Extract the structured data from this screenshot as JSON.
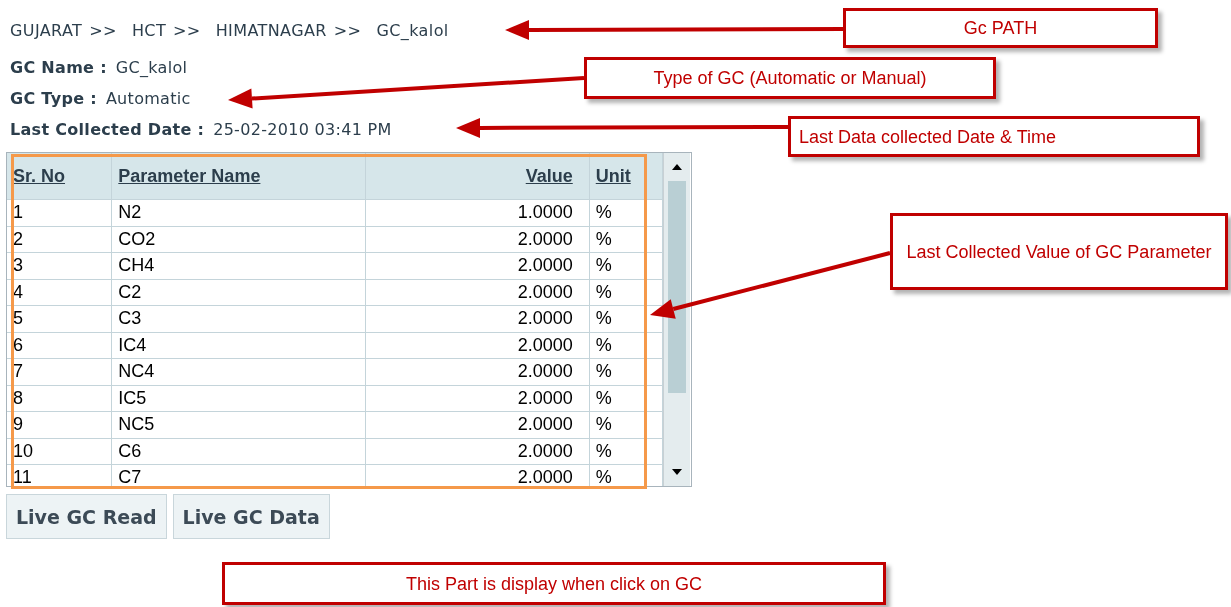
{
  "breadcrumb": [
    {
      "label": "GUJARAT"
    },
    {
      "label": "HCT"
    },
    {
      "label": "HIMATNAGAR"
    },
    {
      "label": "GC_kalol"
    }
  ],
  "breadcrumb_separator": ">>",
  "fields": [
    {
      "label": "GC Name :",
      "value": "GC_kalol"
    },
    {
      "label": "GC Type :",
      "value": "Automatic"
    },
    {
      "label": "Last Collected Date :",
      "value": "25-02-2010 03:41 PM"
    }
  ],
  "table": {
    "columns": [
      {
        "label": "Sr. No"
      },
      {
        "label": "Parameter Name"
      },
      {
        "label": "Value"
      },
      {
        "label": "Unit"
      }
    ],
    "rows": [
      [
        "1",
        "N2",
        "1.0000",
        "%"
      ],
      [
        "2",
        "CO2",
        "2.0000",
        "%"
      ],
      [
        "3",
        "CH4",
        "2.0000",
        "%"
      ],
      [
        "4",
        "C2",
        "2.0000",
        "%"
      ],
      [
        "5",
        "C3",
        "2.0000",
        "%"
      ],
      [
        "6",
        "IC4",
        "2.0000",
        "%"
      ],
      [
        "7",
        "NC4",
        "2.0000",
        "%"
      ],
      [
        "8",
        "IC5",
        "2.0000",
        "%"
      ],
      [
        "9",
        "NC5",
        "2.0000",
        "%"
      ],
      [
        "10",
        "C6",
        "2.0000",
        "%"
      ],
      [
        "11",
        "C7",
        "2.0000",
        "%"
      ]
    ]
  },
  "buttons": [
    "Live GC Read",
    "Live GC Data"
  ],
  "annotations": [
    {
      "text": "Gc PATH"
    },
    {
      "text": "Type of GC (Automatic or Manual)"
    },
    {
      "text": "Last Data collected Date & Time"
    },
    {
      "text": "Last Collected Value of GC Parameter"
    },
    {
      "text": "This Part is display when click on GC"
    }
  ]
}
